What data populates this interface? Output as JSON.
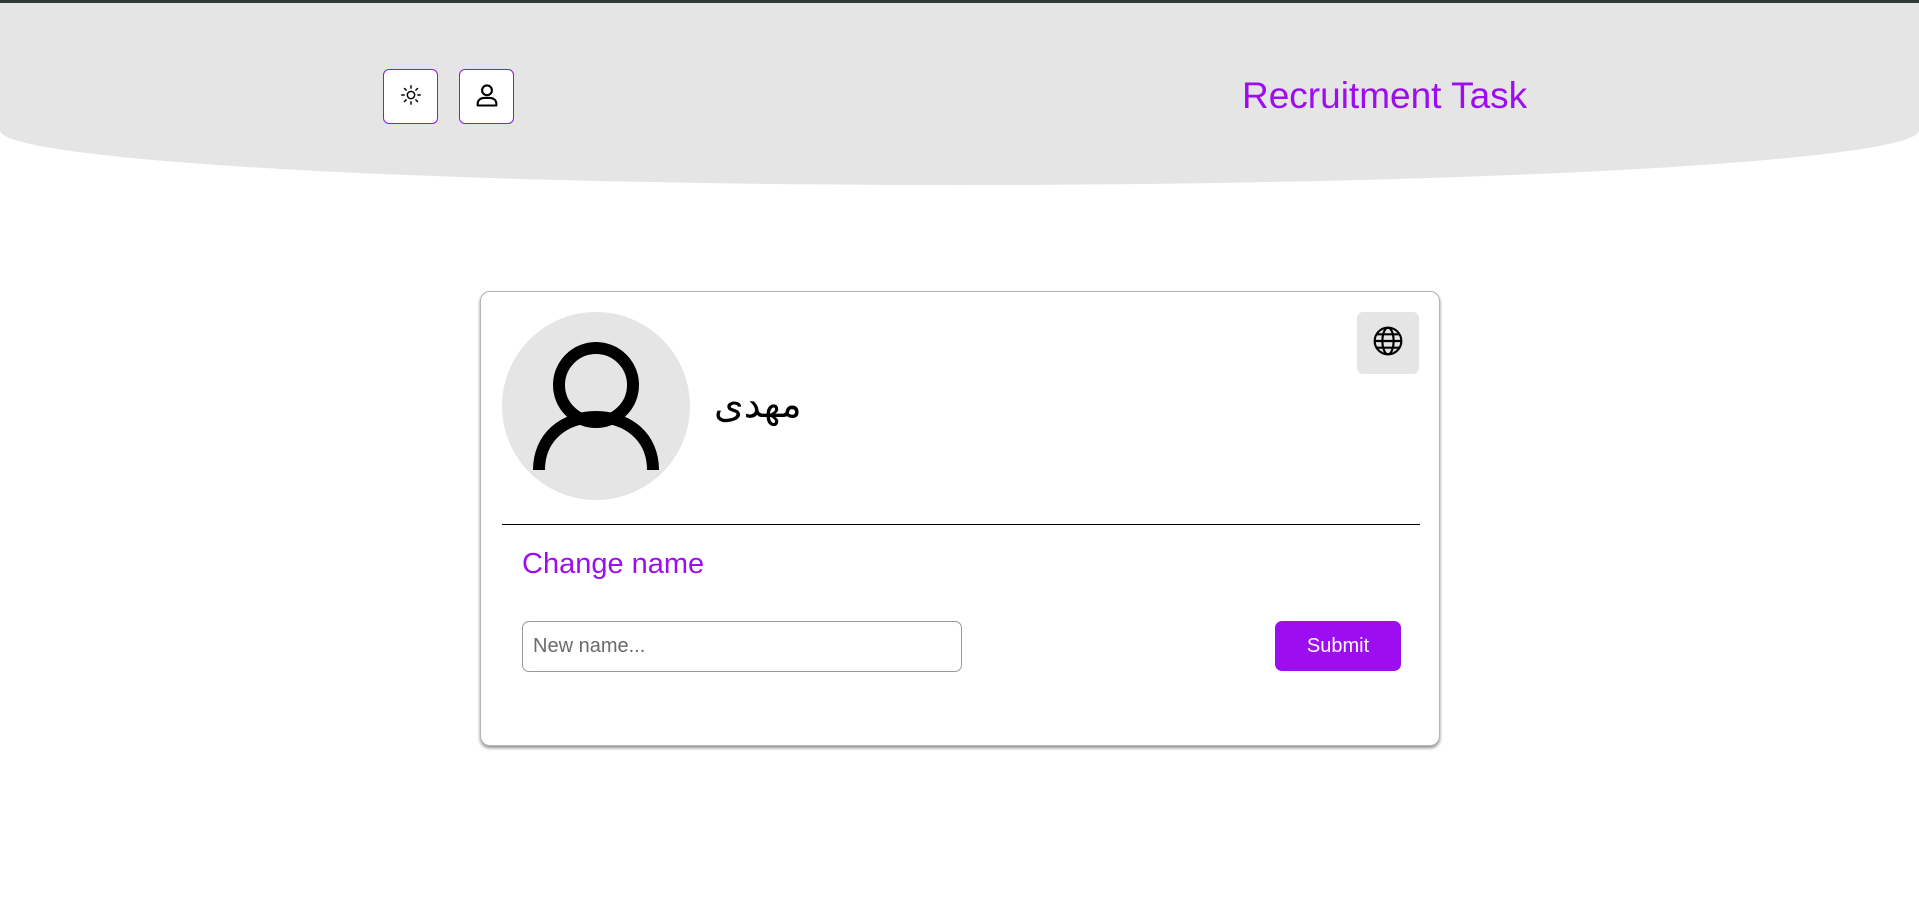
{
  "header": {
    "brand_title": "Recruitment Task",
    "theme_toggle_icon": "sun-icon",
    "profile_icon": "user-icon"
  },
  "profile_card": {
    "avatar_icon": "user-avatar-icon",
    "display_name": "مهدی",
    "language_icon": "globe-icon",
    "change_name_title": "Change name",
    "name_input": {
      "value": "",
      "placeholder": "New name..."
    },
    "submit_label": "Submit"
  },
  "colors": {
    "accent": "#9c0df0",
    "header_bg": "#e5e5e5",
    "avatar_bg": "#e5e5e5",
    "page_bg": "#ffffff"
  }
}
